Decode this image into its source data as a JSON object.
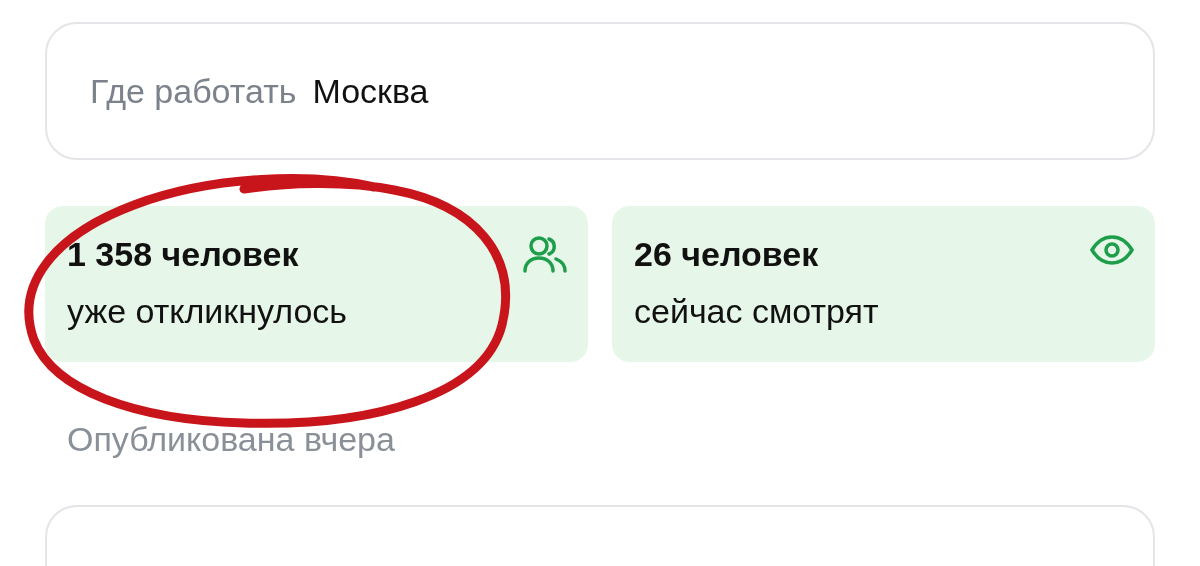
{
  "location": {
    "label": "Где работать",
    "value": "Москва"
  },
  "stats": [
    {
      "kind": "responses",
      "count": "1 358 человек",
      "caption": "уже откликнулось"
    },
    {
      "kind": "viewers",
      "count": "26 человек",
      "caption": "сейчас смотрят"
    }
  ],
  "published": "Опубликована вчера"
}
